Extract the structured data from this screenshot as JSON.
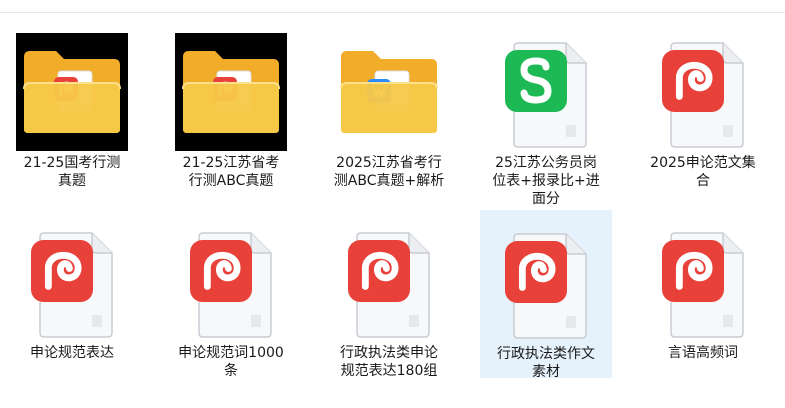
{
  "files": [
    {
      "name": "21-25国考行测真题",
      "line1": "21-25国考行测",
      "line2": "真题",
      "line3": "",
      "type": "folder-pdf",
      "thumb_dark": true,
      "selected": false
    },
    {
      "name": "21-25江苏省考行测ABC真题",
      "line1": "21-25江苏省考",
      "line2": "行测ABC真题",
      "line3": "",
      "type": "folder-pdf",
      "thumb_dark": true,
      "selected": false
    },
    {
      "name": "2025江苏省考行测ABC真题+解析",
      "line1": "2025江苏省考行",
      "line2": "测ABC真题+解析",
      "line3": "",
      "type": "folder-doc",
      "thumb_dark": false,
      "selected": false
    },
    {
      "name": "25江苏公务员岗位表+报录比+进面分",
      "line1": "25江苏公务员岗",
      "line2": "位表+报录比+进",
      "line3": "面分",
      "type": "sheet",
      "thumb_dark": false,
      "selected": false
    },
    {
      "name": "2025申论范文集合",
      "line1": "2025申论范文集",
      "line2": "合",
      "line3": "",
      "type": "pdf",
      "thumb_dark": false,
      "selected": false
    },
    {
      "name": "申论规范表达",
      "line1": "申论规范表达",
      "line2": "",
      "line3": "",
      "type": "pdf",
      "thumb_dark": false,
      "selected": false
    },
    {
      "name": "申论规范词1000条",
      "line1": "申论规范词1000",
      "line2": "条",
      "line3": "",
      "type": "pdf",
      "thumb_dark": false,
      "selected": false
    },
    {
      "name": "行政执法类申论规范表达180组",
      "line1": "行政执法类申论",
      "line2": "规范表达180组",
      "line3": "",
      "type": "pdf",
      "thumb_dark": false,
      "selected": false
    },
    {
      "name": "行政执法类作文素材",
      "line1": "行政执法类作文",
      "line2": "素材",
      "line3": "",
      "type": "pdf",
      "thumb_dark": false,
      "selected": true
    },
    {
      "name": "言语高频词",
      "line1": "言语高频词",
      "line2": "",
      "line3": "",
      "type": "pdf",
      "thumb_dark": false,
      "selected": false
    }
  ],
  "colors": {
    "pdf_red": "#e8413a",
    "sheet_green": "#1db954",
    "folder_yellow": "#f7c948",
    "doc_blue": "#2b8af7",
    "selection": "#e5f1fb"
  },
  "icons": {
    "folder": "folder-icon",
    "pdf": "pdf-file-icon",
    "sheet": "spreadsheet-file-icon",
    "doc": "document-file-icon"
  }
}
